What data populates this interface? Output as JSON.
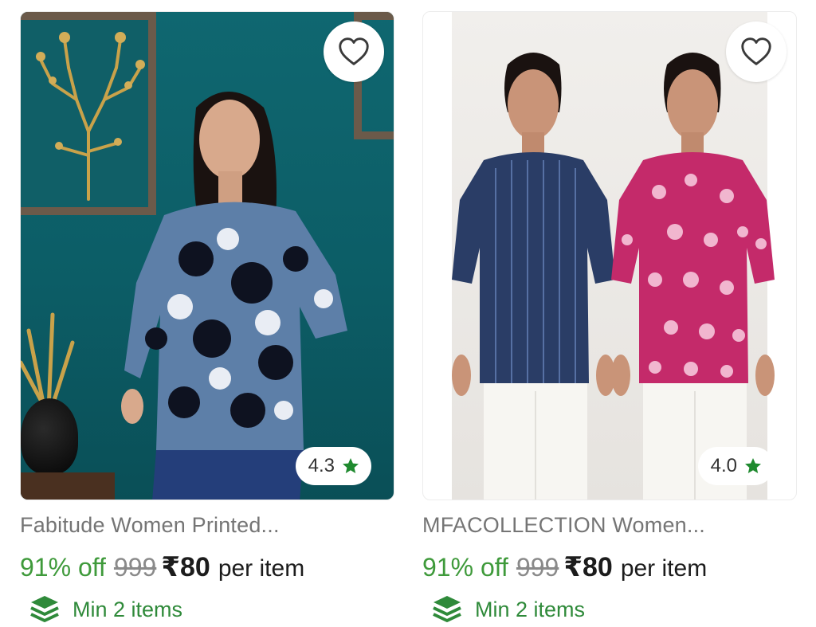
{
  "products": [
    {
      "title": "Fabitude Women Printed...",
      "rating": "4.3",
      "discount": "91% off",
      "mrp": "999",
      "price": "₹80",
      "unit": "per item",
      "min_order": "Min 2 items"
    },
    {
      "title": "MFACOLLECTION Women...",
      "rating": "4.0",
      "discount": "91% off",
      "mrp": "999",
      "price": "₹80",
      "unit": "per item",
      "min_order": "Min 2 items"
    }
  ],
  "icons": {
    "wishlist": "heart-outline-icon",
    "rating": "star-icon",
    "min_order": "layers-icon"
  },
  "colors": {
    "discount": "#3f9a3b",
    "star": "#1f8a2f",
    "min_order": "#2f8a3a",
    "title": "#757575"
  }
}
